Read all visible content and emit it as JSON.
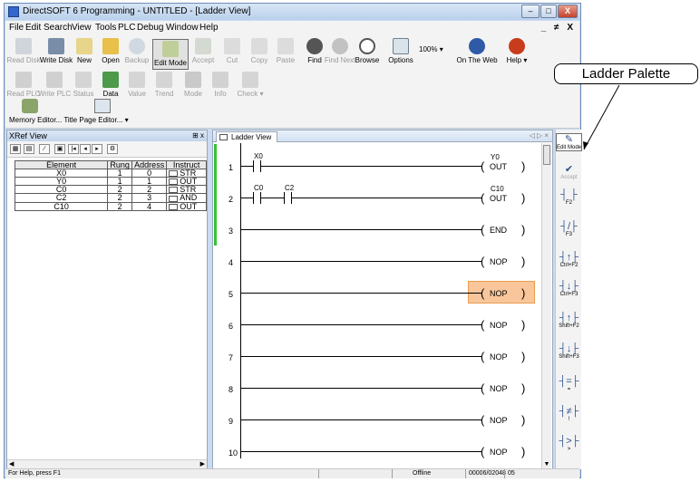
{
  "window": {
    "title": "DirectSOFT 6 Programming - UNTITLED - [Ladder View]",
    "controls": [
      "–",
      "□",
      "X"
    ],
    "mdi_controls": "_ ≠ X"
  },
  "menu": [
    "File",
    "Edit",
    "Search",
    "View",
    "Tools",
    "PLC",
    "Debug",
    "Window",
    "Help"
  ],
  "toolbar": {
    "row1": [
      {
        "label": "Read Disk",
        "icon": "read-disk-icon",
        "enabled": false
      },
      {
        "label": "Write Disk",
        "icon": "write-disk-icon",
        "enabled": true
      },
      {
        "label": "New",
        "icon": "new-icon",
        "enabled": true
      },
      {
        "label": "Open",
        "icon": "open-icon",
        "enabled": true
      },
      {
        "label": "Backup",
        "icon": "backup-icon",
        "enabled": false
      },
      {
        "label": "Edit Mode",
        "icon": "edit-mode-icon",
        "enabled": true,
        "selected": true
      },
      {
        "label": "Accept",
        "icon": "accept-icon",
        "enabled": false
      },
      {
        "label": "Cut",
        "icon": "cut-icon",
        "enabled": false
      },
      {
        "label": "Copy",
        "icon": "copy-icon",
        "enabled": false
      },
      {
        "label": "Paste",
        "icon": "paste-icon",
        "enabled": false
      },
      {
        "label": "Find",
        "icon": "find-icon",
        "enabled": true
      },
      {
        "label": "Find Next",
        "icon": "find-next-icon",
        "enabled": false
      },
      {
        "label": "Browse",
        "icon": "browse-icon",
        "enabled": true
      },
      {
        "label": "Options",
        "icon": "options-icon",
        "enabled": true
      },
      {
        "label": "On The Web",
        "icon": "web-icon",
        "enabled": true
      },
      {
        "label": "Help",
        "icon": "help-icon",
        "enabled": true
      }
    ],
    "zoom": "100%",
    "row2": [
      {
        "label": "Read PLC",
        "icon": "read-plc-icon",
        "enabled": false
      },
      {
        "label": "Write PLC",
        "icon": "write-plc-icon",
        "enabled": false
      },
      {
        "label": "Status",
        "icon": "status-icon",
        "enabled": false
      },
      {
        "label": "Data",
        "icon": "data-icon",
        "enabled": true
      },
      {
        "label": "Value",
        "icon": "value-icon",
        "enabled": false
      },
      {
        "label": "Trend",
        "icon": "trend-icon",
        "enabled": false
      },
      {
        "label": "Mode",
        "icon": "mode-icon",
        "enabled": false
      },
      {
        "label": "Info",
        "icon": "info-icon",
        "enabled": false
      },
      {
        "label": "Check",
        "icon": "check-icon",
        "enabled": false
      }
    ],
    "row3": "Memory Editor...  Title Page Editor..."
  },
  "xref": {
    "title": "XRef View",
    "pin": "⊞ x",
    "columns": [
      "Element",
      "Rung",
      "Address",
      "Instruct"
    ],
    "rows": [
      {
        "element": "X0",
        "rung": "1",
        "address": "0",
        "instr": "STR"
      },
      {
        "element": "Y0",
        "rung": "1",
        "address": "1",
        "instr": "OUT"
      },
      {
        "element": "C0",
        "rung": "2",
        "address": "2",
        "instr": "STR"
      },
      {
        "element": "C2",
        "rung": "2",
        "address": "3",
        "instr": "AND"
      },
      {
        "element": "C10",
        "rung": "2",
        "address": "4",
        "instr": "OUT"
      }
    ]
  },
  "ladder": {
    "tab": "Ladder View",
    "tab_ctrl": "◁ ▷ ×",
    "rungs": [
      {
        "num": "1",
        "contacts": [
          {
            "addr": "X0"
          }
        ],
        "coil_addr": "Y0",
        "coil": "OUT"
      },
      {
        "num": "2",
        "contacts": [
          {
            "addr": "C0"
          },
          {
            "addr": "C2"
          }
        ],
        "coil_addr": "C10",
        "coil": "OUT"
      },
      {
        "num": "3",
        "contacts": [],
        "coil_addr": "",
        "coil": "END"
      },
      {
        "num": "4",
        "contacts": [],
        "coil_addr": "",
        "coil": "NOP"
      },
      {
        "num": "5",
        "contacts": [],
        "coil_addr": "",
        "coil": "NOP",
        "highlight": true
      },
      {
        "num": "6",
        "contacts": [],
        "coil_addr": "",
        "coil": "NOP"
      },
      {
        "num": "7",
        "contacts": [],
        "coil_addr": "",
        "coil": "NOP"
      },
      {
        "num": "8",
        "contacts": [],
        "coil_addr": "",
        "coil": "NOP"
      },
      {
        "num": "9",
        "contacts": [],
        "coil_addr": "",
        "coil": "NOP"
      },
      {
        "num": "10",
        "contacts": [],
        "coil_addr": "",
        "coil": "NOP"
      }
    ]
  },
  "palette": [
    {
      "label": "Edit Mode",
      "glyph": "✎",
      "selected": true,
      "enabled": true
    },
    {
      "label": "Accept",
      "glyph": "✔",
      "enabled": false
    },
    {
      "label": "F2",
      "glyph": "┤ ├",
      "enabled": true
    },
    {
      "label": "F3",
      "glyph": "┤/├",
      "enabled": true
    },
    {
      "label": "Ctrl+F2",
      "glyph": "┤↑├",
      "enabled": true
    },
    {
      "label": "Ctrl+F3",
      "glyph": "┤↓├",
      "enabled": true
    },
    {
      "label": "Shift+F2",
      "glyph": "┤↑├",
      "enabled": true
    },
    {
      "label": "Shift+F3",
      "glyph": "┤↓├",
      "enabled": true
    },
    {
      "label": "=",
      "glyph": "┤=├",
      "enabled": true
    },
    {
      "label": "!",
      "glyph": "┤≠├",
      "enabled": true
    },
    {
      "label": ">",
      "glyph": "┤>├",
      "enabled": true
    }
  ],
  "status": {
    "help": "For Help, press F1",
    "mode": "Offline",
    "memory": "00006/02048",
    "rung": "05"
  },
  "callout": "Ladder Palette",
  "colors": {
    "highlight": "#f9c69b",
    "rail_active": "#35c235",
    "frame": "#c9dcf3"
  }
}
